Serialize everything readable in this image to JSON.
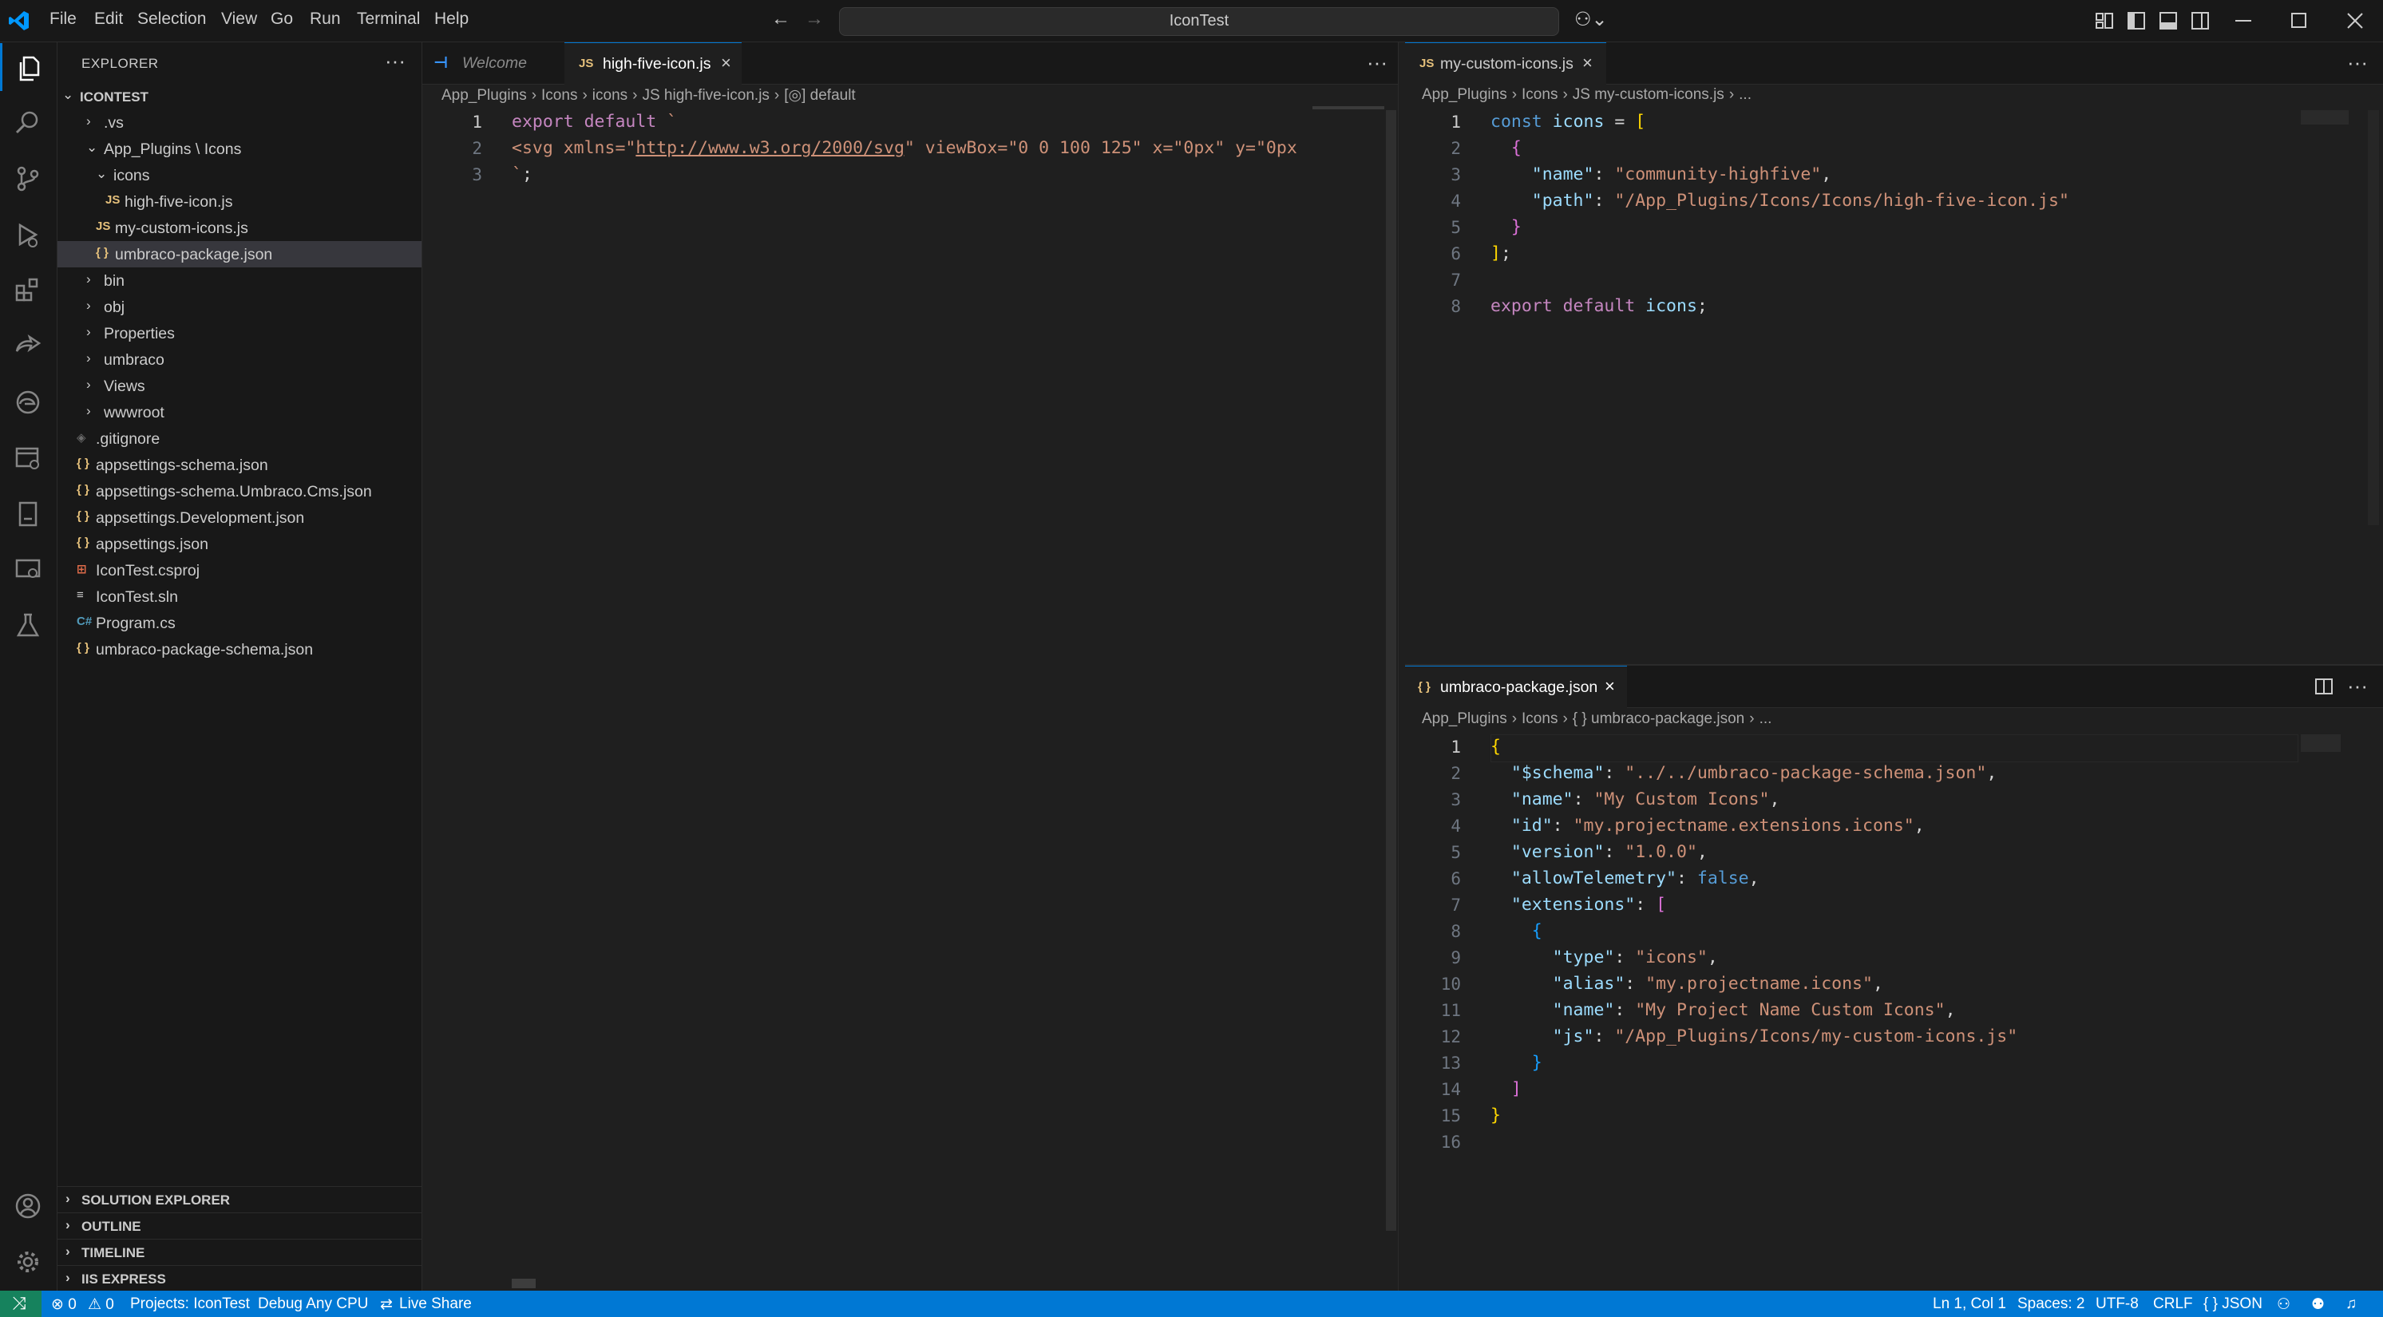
{
  "menu": [
    "File",
    "Edit",
    "Selection",
    "View",
    "Go",
    "Run",
    "Terminal",
    "Help"
  ],
  "search": {
    "text": "IconTest"
  },
  "explorer": {
    "title": "EXPLORER",
    "root": "ICONTEST",
    "items": [
      {
        "label": ".vs",
        "badge": "",
        "badge_color": "",
        "chevron": "›"
      },
      {
        "label": "App_Plugins \\ Icons",
        "badge": "",
        "badge_color": "",
        "chevron": "⌄"
      },
      {
        "label": "icons",
        "badge": "",
        "badge_color": "",
        "chevron": "⌄"
      },
      {
        "label": "high-five-icon.js",
        "badge": "JS",
        "badge_color": "#e5c07b",
        "chevron": ""
      },
      {
        "label": "my-custom-icons.js",
        "badge": "JS",
        "badge_color": "#e5c07b",
        "chevron": ""
      },
      {
        "label": "umbraco-package.json",
        "badge": "{ }",
        "badge_color": "#e5c07b",
        "chevron": ""
      },
      {
        "label": "bin",
        "badge": "",
        "badge_color": "",
        "chevron": "›"
      },
      {
        "label": "obj",
        "badge": "",
        "badge_color": "",
        "chevron": "›"
      },
      {
        "label": "Properties",
        "badge": "",
        "badge_color": "",
        "chevron": "›"
      },
      {
        "label": "umbraco",
        "badge": "",
        "badge_color": "",
        "chevron": "›"
      },
      {
        "label": "Views",
        "badge": "",
        "badge_color": "",
        "chevron": "›"
      },
      {
        "label": "wwwroot",
        "badge": "",
        "badge_color": "",
        "chevron": "›"
      },
      {
        "label": ".gitignore",
        "badge": "◈",
        "badge_color": "#6b6b6b",
        "chevron": ""
      },
      {
        "label": "appsettings-schema.json",
        "badge": "{ }",
        "badge_color": "#e5c07b",
        "chevron": ""
      },
      {
        "label": "appsettings-schema.Umbraco.Cms.json",
        "badge": "{ }",
        "badge_color": "#e5c07b",
        "chevron": ""
      },
      {
        "label": "appsettings.Development.json",
        "badge": "{ }",
        "badge_color": "#e5c07b",
        "chevron": ""
      },
      {
        "label": "appsettings.json",
        "badge": "{ }",
        "badge_color": "#e5c07b",
        "chevron": ""
      },
      {
        "label": "IconTest.csproj",
        "badge": "⊞",
        "badge_color": "#e06c4a",
        "chevron": ""
      },
      {
        "label": "IconTest.sln",
        "badge": "≡",
        "badge_color": "#cccccc",
        "chevron": ""
      },
      {
        "label": "Program.cs",
        "badge": "C#",
        "badge_color": "#519aba",
        "chevron": ""
      },
      {
        "label": "umbraco-package-schema.json",
        "badge": "{ }",
        "badge_color": "#e5c07b",
        "chevron": ""
      }
    ],
    "sections": [
      "SOLUTION EXPLORER",
      "OUTLINE",
      "TIMELINE",
      "IIS EXPRESS"
    ]
  },
  "left_editor": {
    "tabs": [
      {
        "label": "Welcome",
        "badge": "⊣"
      },
      {
        "label": "high-five-icon.js",
        "badge": "JS"
      }
    ],
    "breadcrumb": [
      "App_Plugins",
      "Icons",
      "icons",
      "JS high-five-icon.js",
      "[◎] default"
    ],
    "lines": [
      [
        {
          "t": "export default",
          "c": "k"
        },
        {
          "t": " `",
          "c": "s"
        }
      ],
      [
        {
          "t": "<svg xmlns=\"",
          "c": "s"
        },
        {
          "t": "http://www.w3.org/2000/svg",
          "c": "s u"
        },
        {
          "t": "\" viewBox=\"0 0 100 125\" x=\"0px\" y=\"0px",
          "c": "s"
        }
      ],
      [
        {
          "t": "`",
          "c": "s"
        },
        {
          "t": ";",
          "c": "w"
        }
      ]
    ]
  },
  "right_top_editor": {
    "tab": "my-custom-icons.js",
    "breadcrumb": [
      "App_Plugins",
      "Icons",
      "JS my-custom-icons.js",
      "..."
    ],
    "lines": [
      [
        {
          "t": "const",
          "c": "kb"
        },
        {
          "t": " icons ",
          "c": "v"
        },
        {
          "t": "= ",
          "c": "w"
        },
        {
          "t": "[",
          "c": "y"
        }
      ],
      [
        {
          "t": "  ",
          "c": "w"
        },
        {
          "t": "{",
          "c": "m"
        }
      ],
      [
        {
          "t": "    \"name\"",
          "c": "p"
        },
        {
          "t": ": ",
          "c": "w"
        },
        {
          "t": "\"community-highfive\"",
          "c": "s"
        },
        {
          "t": ",",
          "c": "w"
        }
      ],
      [
        {
          "t": "    \"path\"",
          "c": "p"
        },
        {
          "t": ": ",
          "c": "w"
        },
        {
          "t": "\"/App_Plugins/Icons/Icons/high-five-icon.js\"",
          "c": "s"
        }
      ],
      [
        {
          "t": "  ",
          "c": "w"
        },
        {
          "t": "}",
          "c": "m"
        }
      ],
      [
        {
          "t": "]",
          "c": "y"
        },
        {
          "t": ";",
          "c": "w"
        }
      ],
      [],
      [
        {
          "t": "export default",
          "c": "k"
        },
        {
          "t": " icons",
          "c": "v"
        },
        {
          "t": ";",
          "c": "w"
        }
      ]
    ]
  },
  "right_bottom_editor": {
    "tab": "umbraco-package.json",
    "breadcrumb": [
      "App_Plugins",
      "Icons",
      "{ } umbraco-package.json",
      "..."
    ],
    "lines": [
      [
        {
          "t": "{",
          "c": "y"
        }
      ],
      [
        {
          "t": "  \"$schema\"",
          "c": "p"
        },
        {
          "t": ": ",
          "c": "w"
        },
        {
          "t": "\"../../umbraco-package-schema.json\"",
          "c": "s"
        },
        {
          "t": ",",
          "c": "w"
        }
      ],
      [
        {
          "t": "  \"name\"",
          "c": "p"
        },
        {
          "t": ": ",
          "c": "w"
        },
        {
          "t": "\"My Custom Icons\"",
          "c": "s"
        },
        {
          "t": ",",
          "c": "w"
        }
      ],
      [
        {
          "t": "  \"id\"",
          "c": "p"
        },
        {
          "t": ": ",
          "c": "w"
        },
        {
          "t": "\"my.projectname.extensions.icons\"",
          "c": "s"
        },
        {
          "t": ",",
          "c": "w"
        }
      ],
      [
        {
          "t": "  \"version\"",
          "c": "p"
        },
        {
          "t": ": ",
          "c": "w"
        },
        {
          "t": "\"1.0.0\"",
          "c": "s"
        },
        {
          "t": ",",
          "c": "w"
        }
      ],
      [
        {
          "t": "  \"allowTelemetry\"",
          "c": "p"
        },
        {
          "t": ": ",
          "c": "w"
        },
        {
          "t": "false",
          "c": "kb"
        },
        {
          "t": ",",
          "c": "w"
        }
      ],
      [
        {
          "t": "  \"extensions\"",
          "c": "p"
        },
        {
          "t": ": ",
          "c": "w"
        },
        {
          "t": "[",
          "c": "m"
        }
      ],
      [
        {
          "t": "    ",
          "c": "w"
        },
        {
          "t": "{",
          "c": "b"
        }
      ],
      [
        {
          "t": "      \"type\"",
          "c": "p"
        },
        {
          "t": ": ",
          "c": "w"
        },
        {
          "t": "\"icons\"",
          "c": "s"
        },
        {
          "t": ",",
          "c": "w"
        }
      ],
      [
        {
          "t": "      \"alias\"",
          "c": "p"
        },
        {
          "t": ": ",
          "c": "w"
        },
        {
          "t": "\"my.projectname.icons\"",
          "c": "s"
        },
        {
          "t": ",",
          "c": "w"
        }
      ],
      [
        {
          "t": "      \"name\"",
          "c": "p"
        },
        {
          "t": ": ",
          "c": "w"
        },
        {
          "t": "\"My Project Name Custom Icons\"",
          "c": "s"
        },
        {
          "t": ",",
          "c": "w"
        }
      ],
      [
        {
          "t": "      \"js\"",
          "c": "p"
        },
        {
          "t": ": ",
          "c": "w"
        },
        {
          "t": "\"/App_Plugins/Icons/my-custom-icons.js\"",
          "c": "s"
        }
      ],
      [
        {
          "t": "    ",
          "c": "w"
        },
        {
          "t": "}",
          "c": "b"
        }
      ],
      [
        {
          "t": "  ",
          "c": "w"
        },
        {
          "t": "]",
          "c": "m"
        }
      ],
      [
        {
          "t": "}",
          "c": "y"
        }
      ],
      []
    ]
  },
  "statusbar": {
    "errors": "⊗ 0",
    "warnings": "⚠ 0",
    "projects": "Projects: IconTest",
    "config": "Debug Any CPU",
    "liveshare": "Live Share",
    "position": "Ln 1, Col 1",
    "spaces": "Spaces: 2",
    "encoding": "UTF-8",
    "eol": "CRLF",
    "language": "{ } JSON"
  }
}
